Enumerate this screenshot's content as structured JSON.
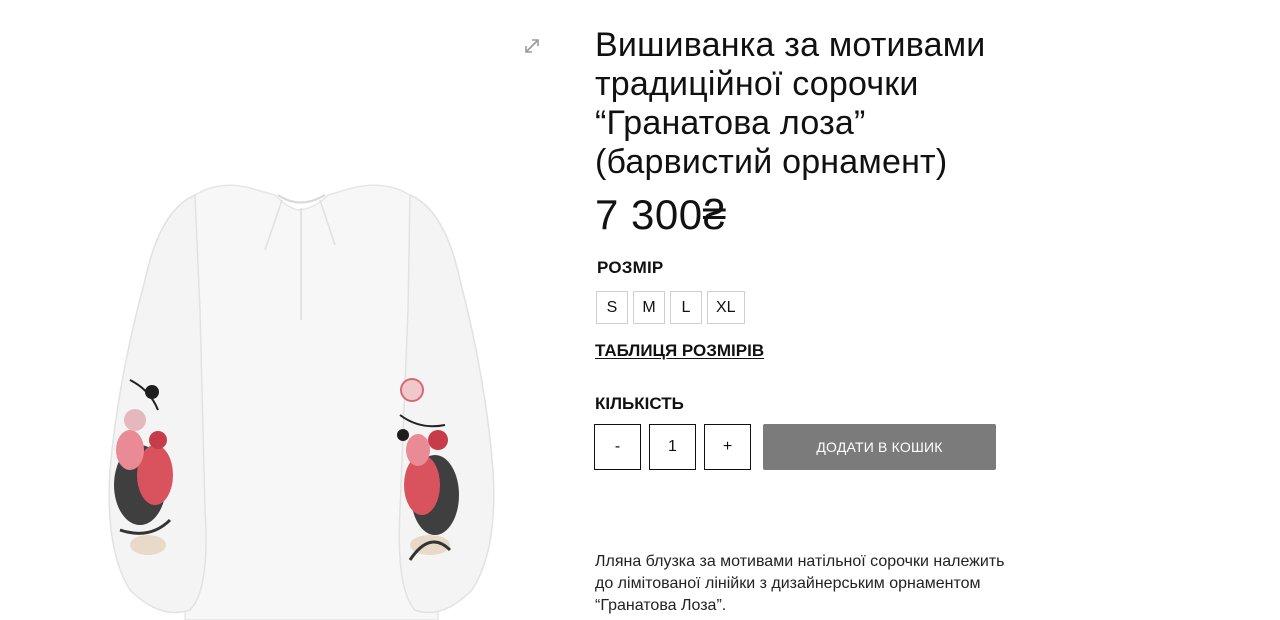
{
  "product": {
    "title_lines": [
      "Вишиванка за мотивами",
      "традиційної сорочки",
      "“Гранатова лоза”",
      "(барвистий орнамент)"
    ],
    "price": "7 300₴",
    "image_alt": "white linen blouse with red and black embroidered sleeves"
  },
  "gallery": {
    "expand_icon": "expand-arrows-icon"
  },
  "size": {
    "label": "РОЗМІР",
    "options": [
      "S",
      "M",
      "L",
      "XL"
    ],
    "table_link": "ТАБЛИЦЯ РОЗМІРІВ"
  },
  "quantity": {
    "label": "КІЛЬКІСТЬ",
    "minus": "-",
    "value": "1",
    "plus": "+"
  },
  "cart": {
    "add_label": "ДОДАТИ В КОШИК",
    "button_color": "#7b7b7b"
  },
  "description": {
    "lines": [
      "Лляна блузка за мотивами натільної сорочки належить",
      "до лімітованої лінійки з дизайнерським орнаментом",
      "“Гранатова Лоза”."
    ]
  }
}
